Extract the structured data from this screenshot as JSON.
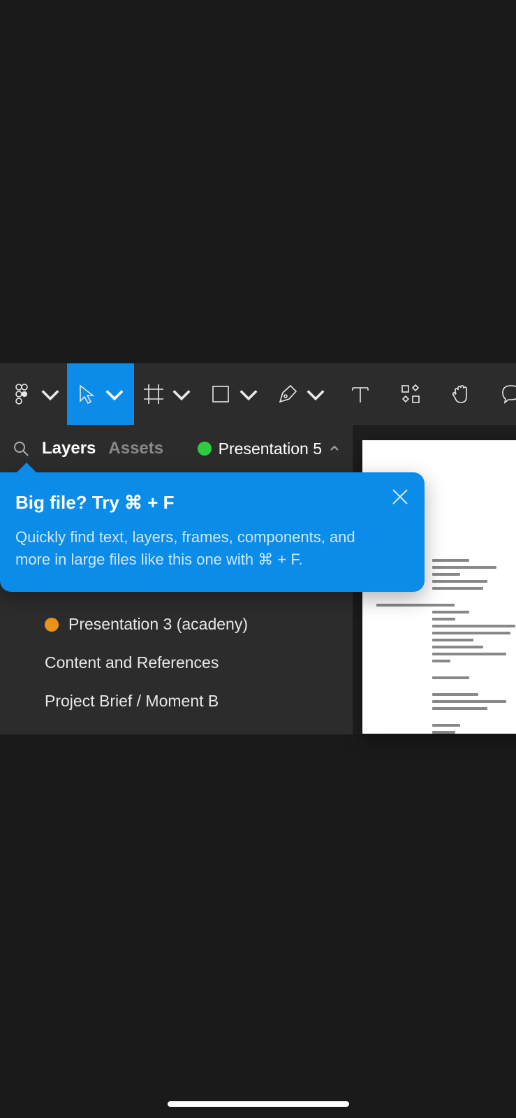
{
  "toolbar": {
    "menu_icon": "figma-logo-icon",
    "tools": [
      {
        "name": "move-tool-icon",
        "hasChevron": true,
        "active": true
      },
      {
        "name": "frame-tool-icon",
        "hasChevron": true,
        "active": false
      },
      {
        "name": "shape-tool-icon",
        "hasChevron": true,
        "active": false
      },
      {
        "name": "pen-tool-icon",
        "hasChevron": true,
        "active": false
      },
      {
        "name": "text-tool-icon",
        "hasChevron": false,
        "active": false
      },
      {
        "name": "resources-tool-icon",
        "hasChevron": false,
        "active": false
      },
      {
        "name": "hand-tool-icon",
        "hasChevron": false,
        "active": false
      },
      {
        "name": "comment-tool-icon",
        "hasChevron": false,
        "active": false
      }
    ]
  },
  "panel": {
    "tabs": {
      "layers": "Layers",
      "assets": "Assets"
    },
    "activeTab": "layers",
    "currentPage": {
      "statusColor": "#2ecc40",
      "name": "Presentation 5"
    }
  },
  "tooltip": {
    "title": "Big file? Try ⌘ + F",
    "body": "Quickly find text, layers, frames, components, and more in large files like this one with ⌘ + F."
  },
  "layers": [
    {
      "dotColor": "#e8921c",
      "label": "Presentation 3 (acadeny)"
    },
    {
      "dotColor": null,
      "label": "Content and References"
    },
    {
      "dotColor": null,
      "label": "Project Brief / Moment B"
    }
  ]
}
